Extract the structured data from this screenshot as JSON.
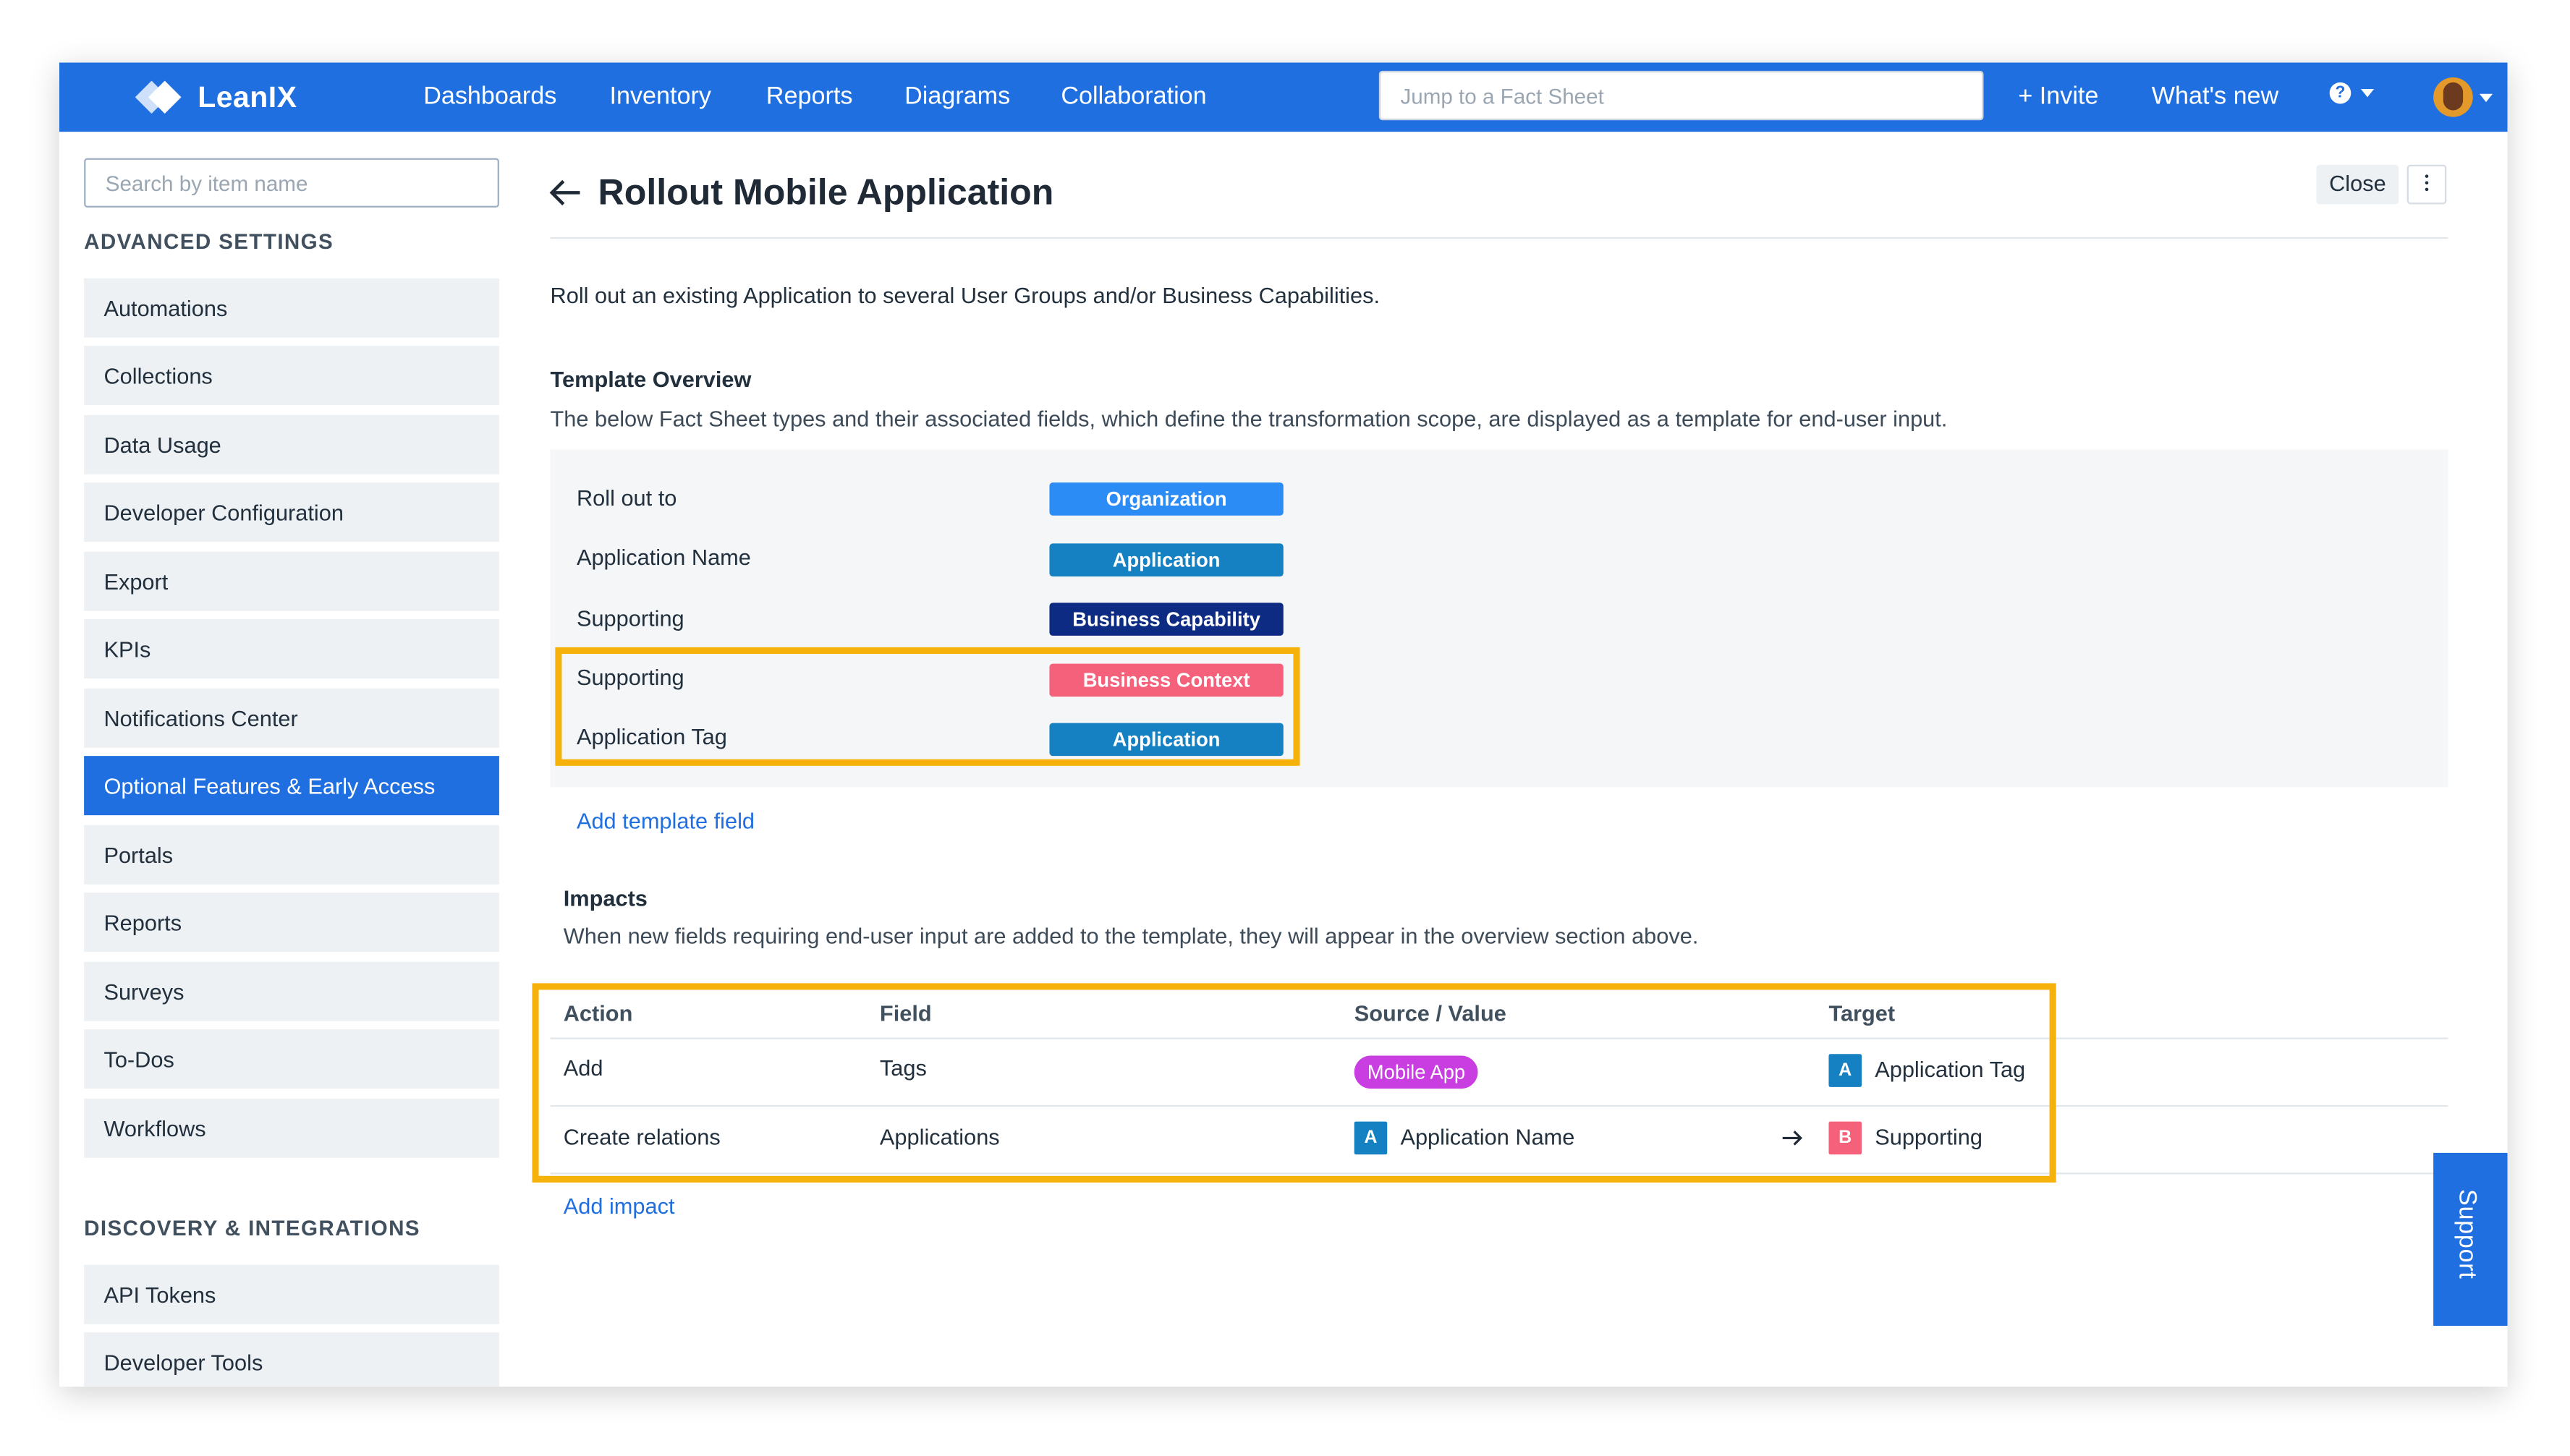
{
  "nav": {
    "brand": "LeanIX",
    "links": [
      "Dashboards",
      "Inventory",
      "Reports",
      "Diagrams",
      "Collaboration"
    ],
    "search_placeholder": "Jump to a Fact Sheet",
    "invite": "+ Invite",
    "whats_new": "What's new",
    "help_glyph": "?",
    "colors": {
      "bar": "#1f6fe0"
    }
  },
  "sidebar": {
    "search_placeholder": "Search by item name",
    "advanced_heading": "ADVANCED SETTINGS",
    "advanced_items": [
      "Automations",
      "Collections",
      "Data Usage",
      "Developer Configuration",
      "Export",
      "KPIs",
      "Notifications Center",
      "Optional Features & Early Access",
      "Portals",
      "Reports",
      "Surveys",
      "To-Dos",
      "Workflows"
    ],
    "active_item": "Optional Features & Early Access",
    "discovery_heading": "DISCOVERY & INTEGRATIONS",
    "discovery_items": [
      "API Tokens",
      "Developer Tools"
    ]
  },
  "main": {
    "title": "Rollout Mobile Application",
    "close_label": "Close",
    "description": "Roll out an existing Application to several User Groups and/or Business Capabilities.",
    "overview_title": "Template Overview",
    "overview_text": "The below Fact Sheet types and their associated fields, which define the transformation scope, are displayed as a template for end-user input.",
    "template_rows": [
      {
        "label": "Roll out to",
        "type": "Organization",
        "color": "#2b8cf5"
      },
      {
        "label": "Application Name",
        "type": "Application",
        "color": "#1581c2"
      },
      {
        "label": "Supporting",
        "type": "Business Capability",
        "color": "#0d2b82"
      },
      {
        "label": "Supporting",
        "type": "Business Context",
        "color": "#f5607a"
      },
      {
        "label": "Application Tag",
        "type": "Application",
        "color": "#1581c2"
      }
    ],
    "add_template_field": "Add template field",
    "impacts_title": "Impacts",
    "impacts_text": "When new fields requiring end-user input are added to the template, they will appear in the overview section above.",
    "impacts_headers": [
      "Action",
      "Field",
      "Source / Value",
      "Target"
    ],
    "impacts_rows": [
      {
        "action": "Add",
        "field": "Tags",
        "source_tag": "Mobile App",
        "target_badge": "A",
        "target": "Application Tag"
      },
      {
        "action": "Create relations",
        "field": "Applications",
        "source_badge": "A",
        "source": "Application Name",
        "target_badge": "B",
        "target": "Supporting"
      }
    ],
    "add_impact": "Add impact",
    "colors": {
      "highlight": "#f6b10b",
      "tag": "#c83ee0",
      "badge_a": "#1581c2",
      "badge_b": "#f5607a"
    }
  },
  "support_label": "Support"
}
